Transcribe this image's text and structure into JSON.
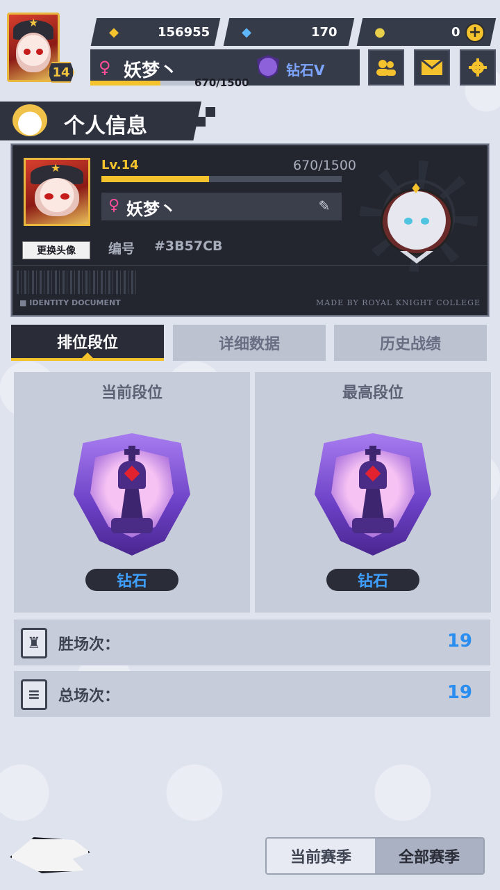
{
  "top_bar": {
    "level": "14",
    "resources": [
      {
        "name": "gold-coin",
        "value": "156955"
      },
      {
        "name": "diamond",
        "value": "170"
      },
      {
        "name": "token",
        "value": "0"
      }
    ],
    "player_name": "妖梦丶",
    "gender_symbol": "♀",
    "rank_name": "钻石V",
    "exp_text": "670/1500",
    "exp_fraction": 0.447,
    "plus_label": "+",
    "buttons": {
      "friends_icon": "friends-icon",
      "mail_icon": "mail-icon",
      "settings_icon": "gear-icon"
    }
  },
  "section": {
    "title": "个人信息"
  },
  "id_card": {
    "level_label": "Lv.14",
    "exp_text": "670/1500",
    "exp_fraction": 0.447,
    "gender_symbol": "♀",
    "player_name": "妖梦丶",
    "edit_icon": "✎",
    "change_avatar_label": "更换头像",
    "id_label": "编号",
    "id_value": "#3B57CB",
    "footer_left": "■ IDENTITY DOCUMENT",
    "footer_right": "MADE BY ROYAL KNIGHT COLLEGE"
  },
  "tabs": [
    {
      "label": "排位段位",
      "active": true
    },
    {
      "label": "详细数据",
      "active": false
    },
    {
      "label": "历史战绩",
      "active": false
    }
  ],
  "rank": {
    "current": {
      "title": "当前段位",
      "tier": "钻石"
    },
    "highest": {
      "title": "最高段位",
      "tier": "钻石"
    }
  },
  "stats": [
    {
      "label": "胜场次：",
      "value": "19",
      "icon": "tower-icon"
    },
    {
      "label": "总场次：",
      "value": "19",
      "icon": "list-icon"
    }
  ],
  "season": {
    "current_label": "当前赛季",
    "all_label": "全部赛季"
  },
  "colors": {
    "accent_yellow": "#f3c22c",
    "panel_dark": "#2a2d38",
    "stat_blue": "#2a8df0",
    "gender_pink": "#ff4d9a"
  }
}
